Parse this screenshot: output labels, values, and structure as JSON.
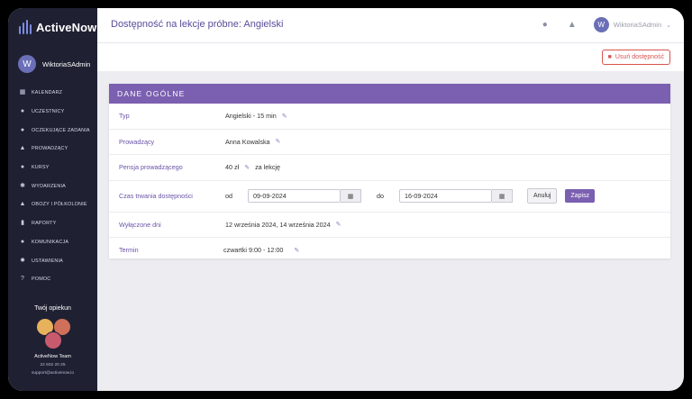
{
  "brand": {
    "name": "ActiveNow"
  },
  "sidebar": {
    "user_initial": "W",
    "user_name": "WiktoriaSAdmin",
    "items": [
      {
        "label": "KALENDARZ",
        "icon": "calendar-icon"
      },
      {
        "label": "UCZESTNICY",
        "icon": "person-icon"
      },
      {
        "label": "OCZEKUJĄCE ZADANIA",
        "icon": "person-clock-icon"
      },
      {
        "label": "PROWADZĄCY",
        "icon": "graduation-cap-icon"
      },
      {
        "label": "KURSY",
        "icon": "group-icon"
      },
      {
        "label": "WYDARZENIA",
        "icon": "fireworks-icon"
      },
      {
        "label": "OBOZY I PÓŁKOLONIE",
        "icon": "tent-icon"
      },
      {
        "label": "RAPORTY",
        "icon": "chart-icon"
      },
      {
        "label": "KOMUNIKACJA",
        "icon": "chat-icon"
      },
      {
        "label": "USTAWIENIA",
        "icon": "gear-icon"
      },
      {
        "label": "POMOC",
        "icon": "help-icon"
      }
    ],
    "guardian": {
      "title": "Twój opiekun",
      "team": "ActiveNow Team",
      "phone": "22 602 20 25",
      "email": "support@activenow.io"
    }
  },
  "header": {
    "title": "Dostępność na lekcje próbne: Angielski",
    "user_initial": "W",
    "user_name": "WiktoriaSAdmin"
  },
  "actions": {
    "delete_label": "Usuń dostępność"
  },
  "card": {
    "title": "DANE OGÓLNE",
    "type_label": "Typ",
    "type_value": "Angielski - 15 min",
    "teacher_label": "Prowadzący",
    "teacher_value": "Anna Kowalska",
    "salary_label": "Pensja prowadzącego",
    "salary_value": "40 zł",
    "salary_suffix": "za lekcję",
    "duration_label": "Czas trwania dostępności",
    "from_label": "od",
    "from_value": "09-09-2024",
    "to_label": "do",
    "to_value": "16-09-2024",
    "cancel_label": "Anuluj",
    "save_label": "Zapisz",
    "excluded_label": "Wyłączone dni",
    "excluded_value": "12 września 2024, 14 września 2024",
    "term_label": "Termin",
    "term_value": "czwartki 9:00 - 12:00"
  },
  "colors": {
    "accent": "#7b5fb0",
    "sidebar": "#1f2133",
    "danger": "#d9534f"
  }
}
